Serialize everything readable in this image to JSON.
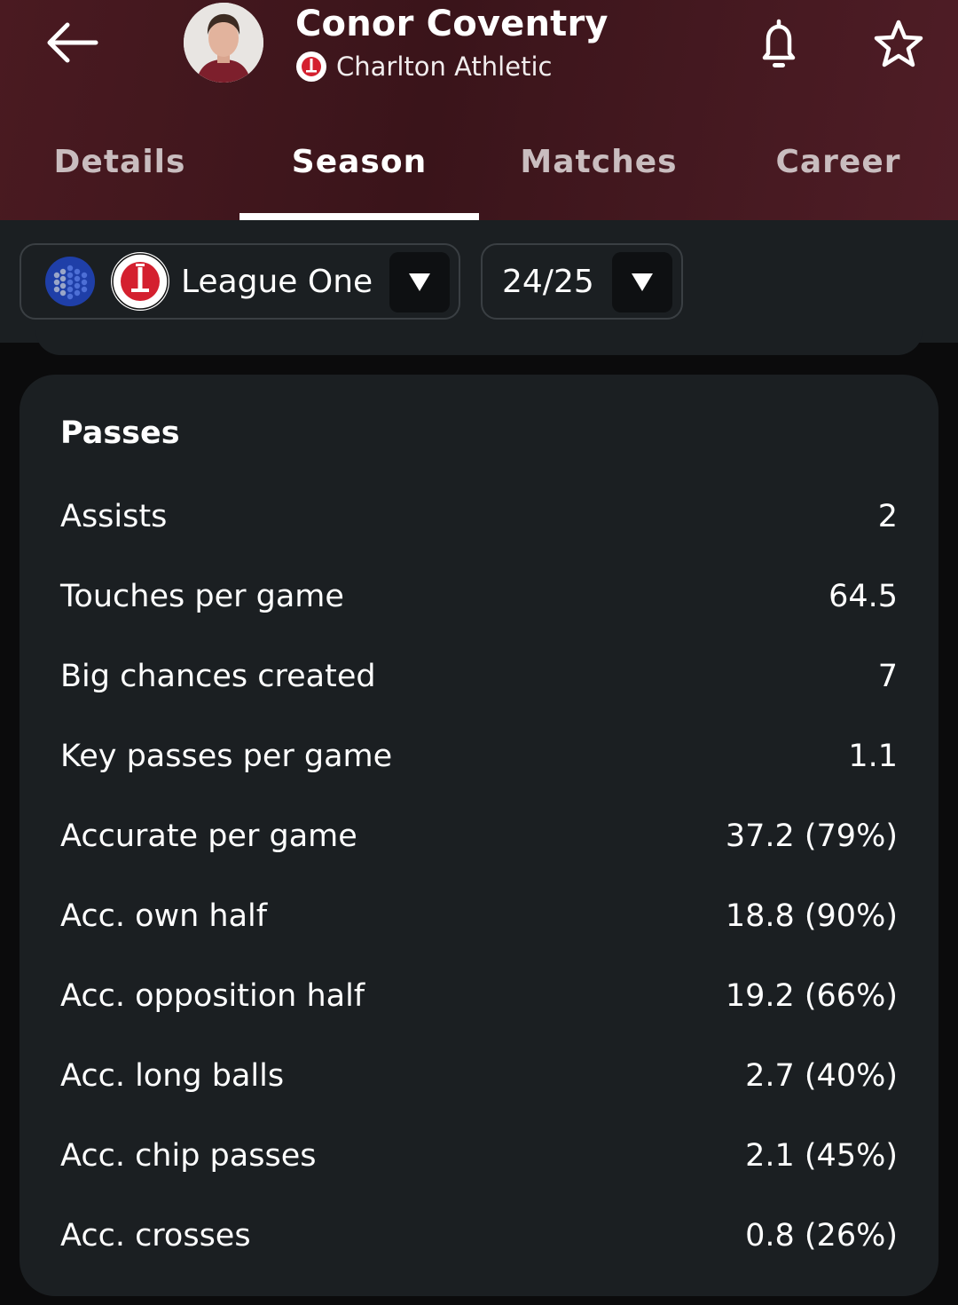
{
  "header": {
    "player_name": "Conor Coventry",
    "club_name": "Charlton Athletic",
    "background_color": "#45181f"
  },
  "icons": {
    "back": "arrow-left-icon",
    "notifications": "bell-icon",
    "favorite": "star-outline-icon"
  },
  "tabs": [
    {
      "label": "Details",
      "active": false
    },
    {
      "label": "Season",
      "active": true
    },
    {
      "label": "Matches",
      "active": false
    },
    {
      "label": "Career",
      "active": false
    }
  ],
  "filters": {
    "competition": "League One",
    "season": "24/25"
  },
  "passes": {
    "title": "Passes",
    "rows": [
      {
        "label": "Assists",
        "value": "2"
      },
      {
        "label": "Touches per game",
        "value": "64.5"
      },
      {
        "label": "Big chances created",
        "value": "7"
      },
      {
        "label": "Key passes per game",
        "value": "1.1"
      },
      {
        "label": "Accurate per game",
        "value": "37.2 (79%)"
      },
      {
        "label": "Acc. own half",
        "value": "18.8 (90%)"
      },
      {
        "label": "Acc. opposition half",
        "value": "19.2 (66%)"
      },
      {
        "label": "Acc. long balls",
        "value": "2.7 (40%)"
      },
      {
        "label": "Acc. chip passes",
        "value": "2.1 (45%)"
      },
      {
        "label": "Acc. crosses",
        "value": "0.8 (26%)"
      }
    ]
  }
}
